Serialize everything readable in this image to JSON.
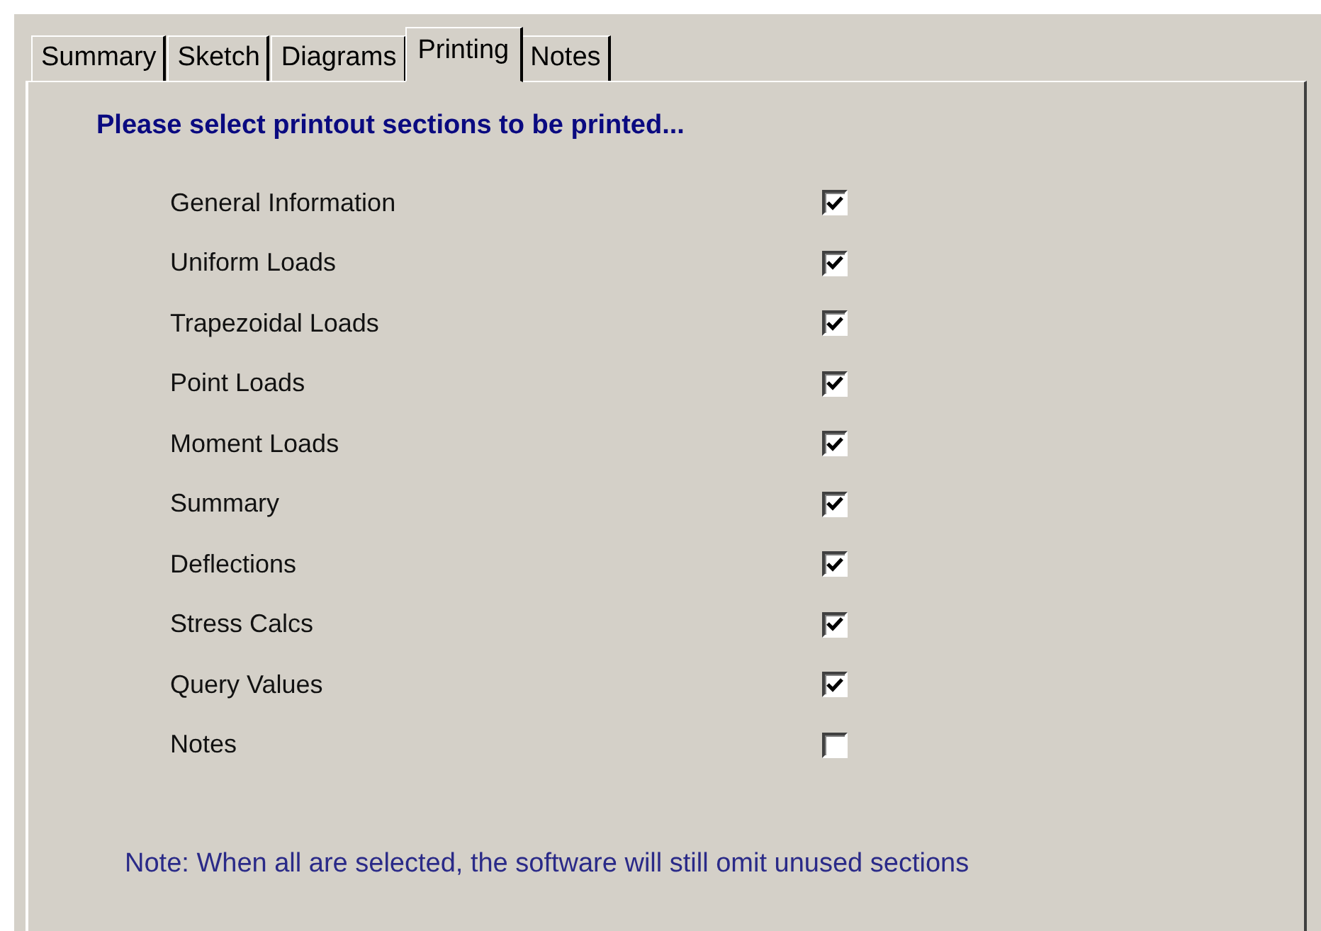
{
  "tabs": [
    {
      "label": "Summary",
      "selected": false
    },
    {
      "label": "Sketch",
      "selected": false
    },
    {
      "label": "Diagrams",
      "selected": false
    },
    {
      "label": "Printing",
      "selected": true
    },
    {
      "label": "Notes",
      "selected": false
    }
  ],
  "heading": "Please select printout sections to be printed...",
  "sections": [
    {
      "label": "General Information",
      "checked": true
    },
    {
      "label": "Uniform Loads",
      "checked": true
    },
    {
      "label": "Trapezoidal Loads",
      "checked": true
    },
    {
      "label": "Point Loads",
      "checked": true
    },
    {
      "label": "Moment Loads",
      "checked": true
    },
    {
      "label": "Summary",
      "checked": true
    },
    {
      "label": "Deflections",
      "checked": true
    },
    {
      "label": "Stress Calcs",
      "checked": true
    },
    {
      "label": "Query Values",
      "checked": true
    },
    {
      "label": "Notes",
      "checked": false
    }
  ],
  "note": "Note:  When all are selected, the software will still omit unused sections"
}
